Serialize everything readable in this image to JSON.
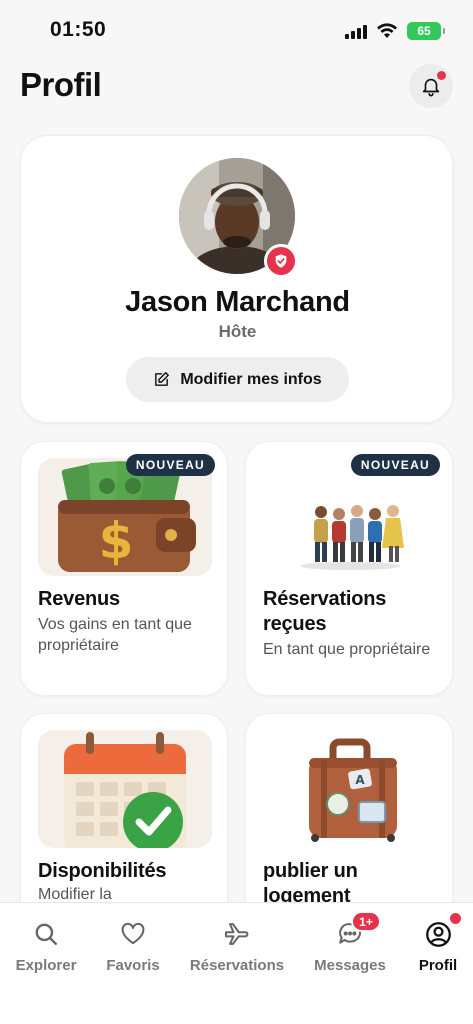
{
  "status_bar": {
    "time": "01:50",
    "battery_level": "65",
    "icons": [
      "signal-icon",
      "wifi-icon",
      "battery-icon"
    ]
  },
  "header": {
    "title": "Profil",
    "notifications_icon": "bell-icon",
    "has_unread_notifications": true
  },
  "profile": {
    "name": "Jason Marchand",
    "role": "Hôte",
    "edit_label": "Modifier mes infos",
    "verified": true
  },
  "cards": [
    {
      "title": "Revenus",
      "subtitle": "Vos gains en tant que propriétaire",
      "badge": "NOUVEAU",
      "icon": "wallet-money-icon"
    },
    {
      "title": "Réservations reçues",
      "subtitle": "En tant que propriétaire",
      "badge": "NOUVEAU",
      "icon": "people-group-icon"
    },
    {
      "title": "Disponibilités",
      "subtitle": "Modifier la",
      "badge": "",
      "icon": "calendar-check-icon"
    },
    {
      "title": "publier un logement",
      "subtitle": "",
      "badge": "",
      "icon": "suitcase-icon"
    }
  ],
  "bottom_nav": {
    "items": [
      {
        "label": "Explorer",
        "icon": "search-icon",
        "active": false
      },
      {
        "label": "Favoris",
        "icon": "heart-icon",
        "active": false
      },
      {
        "label": "Réservations",
        "icon": "airplane-icon",
        "active": false
      },
      {
        "label": "Messages",
        "icon": "chat-icon",
        "active": false,
        "badge": "1+"
      },
      {
        "label": "Profil",
        "icon": "user-circle-icon",
        "active": true
      }
    ]
  },
  "colors": {
    "accent": "#e5334b",
    "badge_bg": "#1f3146",
    "battery": "#34c759",
    "background": "#f7f7f7"
  }
}
